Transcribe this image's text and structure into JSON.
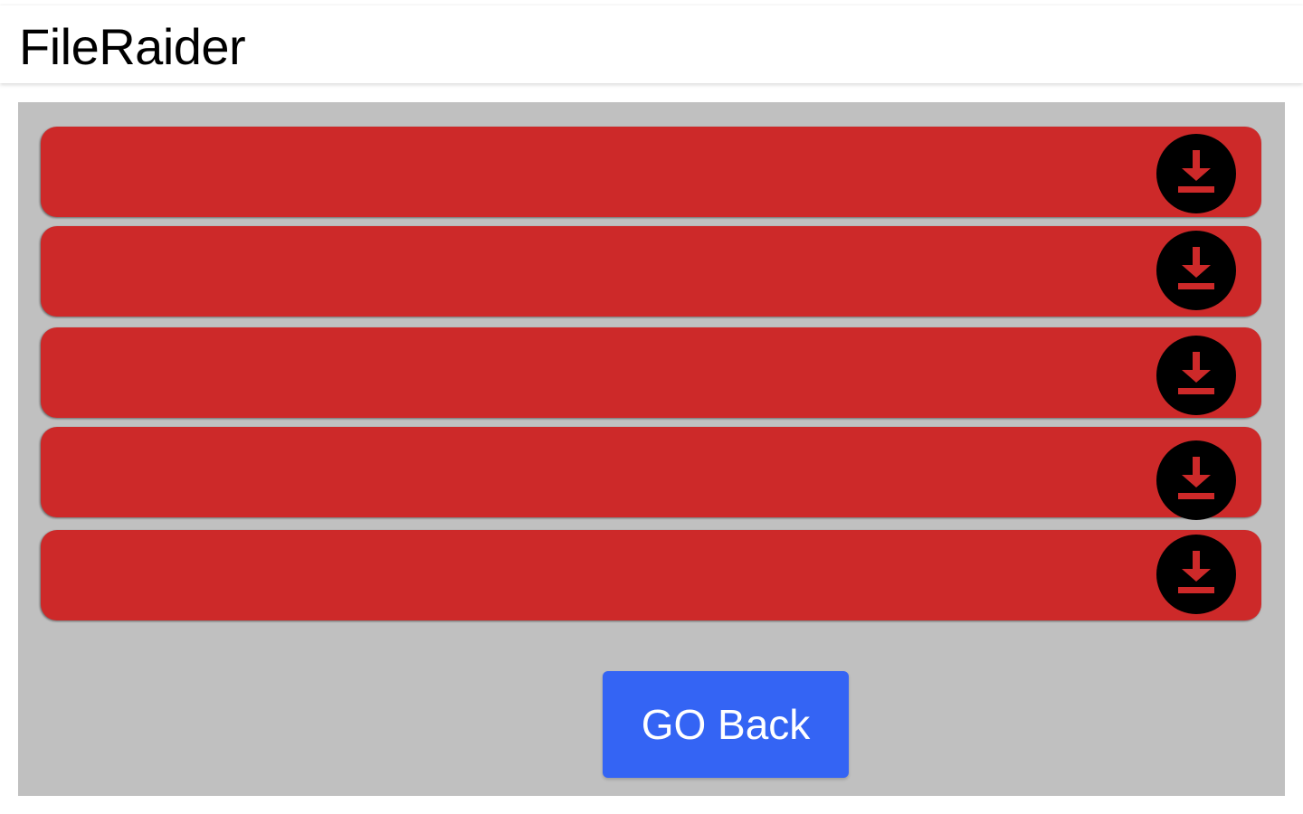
{
  "app": {
    "title": "FileRaider"
  },
  "files": [
    {
      "label": "",
      "download_icon": "download-icon"
    },
    {
      "label": "",
      "download_icon": "download-icon"
    },
    {
      "label": "",
      "download_icon": "download-icon"
    },
    {
      "label": "",
      "download_icon": "download-icon"
    },
    {
      "label": "",
      "download_icon": "download-icon"
    }
  ],
  "actions": {
    "go_back_label": "GO Back"
  },
  "colors": {
    "header_bg": "#ffffff",
    "panel_bg": "#c0c0c0",
    "file_row_bg": "#cd2929",
    "download_button_bg": "#000000",
    "download_icon_color": "#cd2929",
    "go_back_bg": "#3464f4",
    "go_back_text": "#ffffff"
  }
}
